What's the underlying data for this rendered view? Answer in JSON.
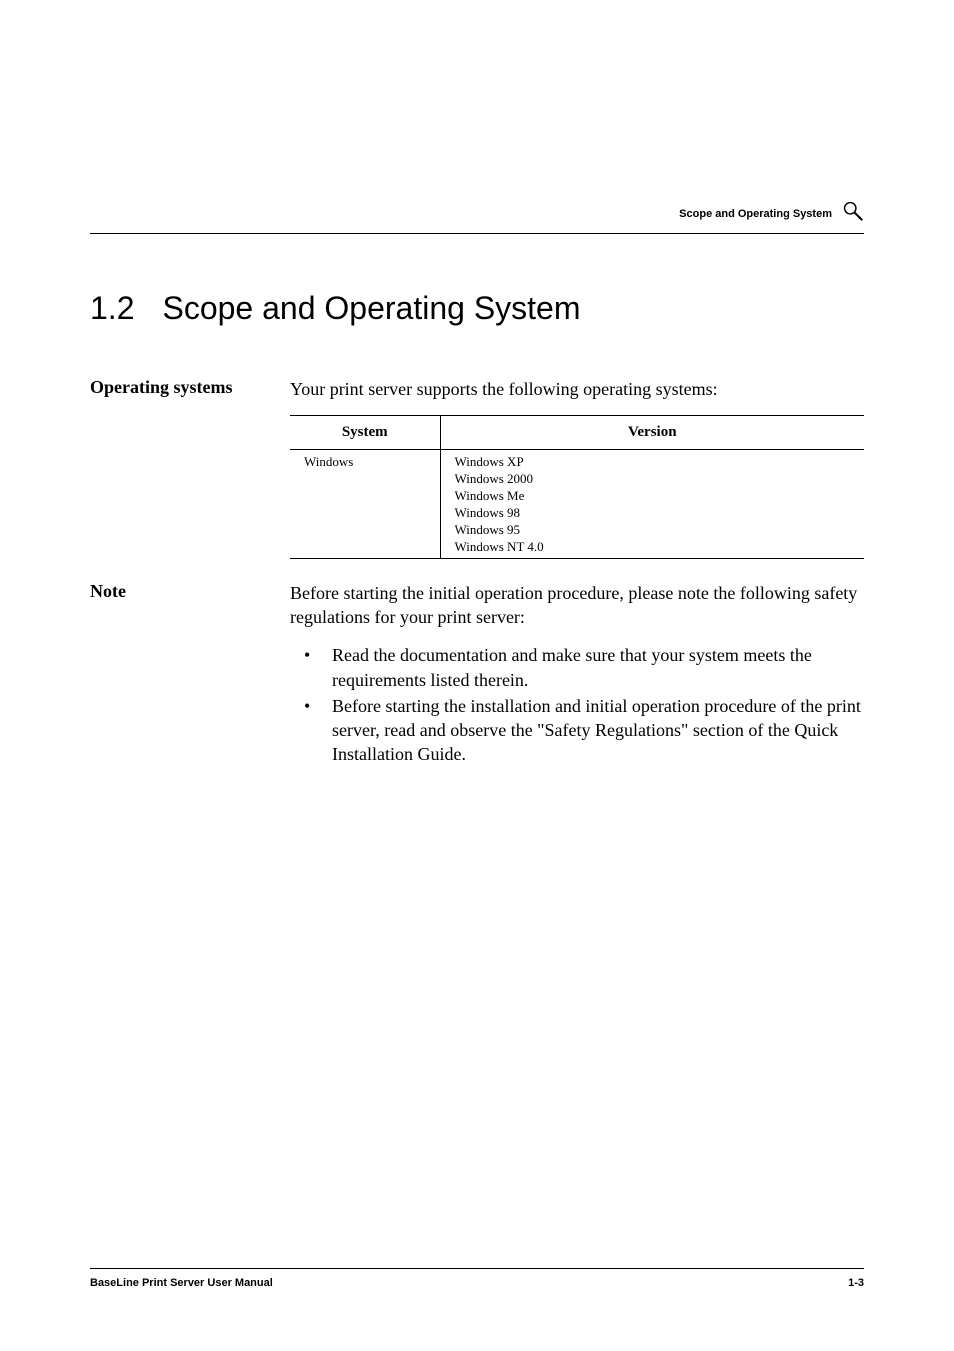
{
  "header": {
    "running_title": "Scope and Operating System"
  },
  "section": {
    "number": "1.2",
    "title": "Scope and Operating System"
  },
  "margin_labels": {
    "operating_systems": "Operating systems",
    "note": "Note"
  },
  "body": {
    "intro": "Your print server supports the following operating systems:",
    "note_text": "Before starting the initial operation procedure, please note the following safety regulations for your print server:",
    "bullets": [
      "Read the documentation and make sure that your system meets the requirements listed therein.",
      "Before starting the installation and initial operation procedure of the print server, read and observe the \"Safety Regulations\" section of the Quick Installation Guide."
    ]
  },
  "table": {
    "headers": {
      "system": "System",
      "version": "Version"
    },
    "rows": [
      {
        "system": "Windows",
        "versions": [
          "Windows XP",
          "Windows 2000",
          "Windows Me",
          "Windows 98",
          "Windows 95",
          "Windows NT 4.0"
        ]
      }
    ]
  },
  "footer": {
    "manual_title": "BaseLine Print Server User Manual",
    "page_number": "1-3"
  }
}
